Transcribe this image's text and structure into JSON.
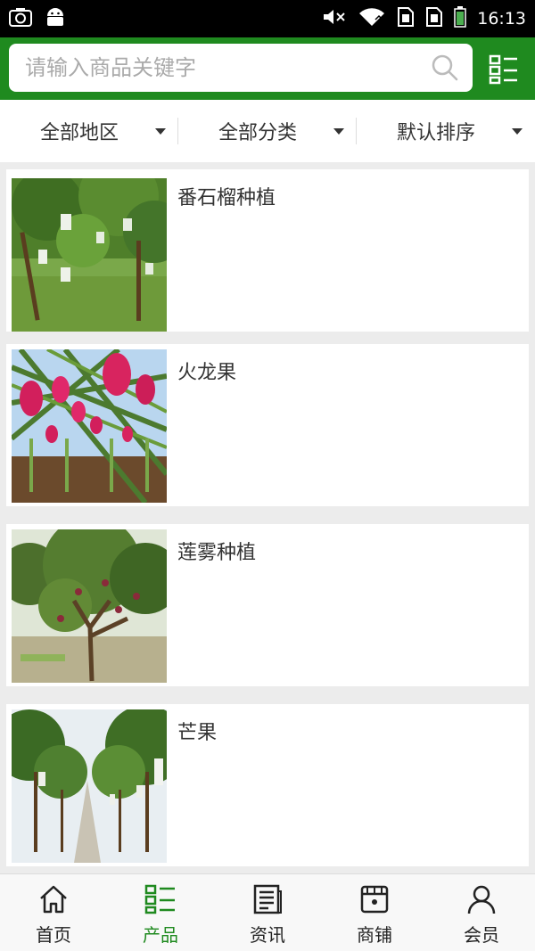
{
  "status_bar": {
    "time": "16:13",
    "icons": [
      "screenshot-icon",
      "android-icon",
      "mute-icon",
      "wifi-icon",
      "sim-icon",
      "sim-icon",
      "battery-icon"
    ]
  },
  "search": {
    "placeholder": "请输入商品关键字",
    "icon": "search-icon"
  },
  "header": {
    "menu_icon": "grid-list-icon",
    "brand_color": "#1f8a1f"
  },
  "filters": [
    {
      "label": "全部地区"
    },
    {
      "label": "全部分类"
    },
    {
      "label": "默认排序"
    }
  ],
  "products": [
    {
      "title": "番石榴种植"
    },
    {
      "title": "火龙果"
    },
    {
      "title": "莲雾种植"
    },
    {
      "title": "芒果"
    }
  ],
  "tabs": [
    {
      "label": "首页",
      "icon": "home-icon",
      "active": false
    },
    {
      "label": "产品",
      "icon": "product-list-icon",
      "active": true
    },
    {
      "label": "资讯",
      "icon": "news-icon",
      "active": false
    },
    {
      "label": "商铺",
      "icon": "shop-icon",
      "active": false
    },
    {
      "label": "会员",
      "icon": "user-icon",
      "active": false
    }
  ]
}
